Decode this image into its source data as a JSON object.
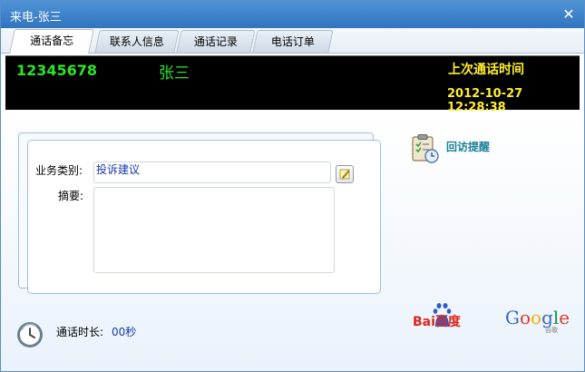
{
  "window": {
    "title": "来电-张三",
    "close_glyph": "✕"
  },
  "tabs": [
    {
      "label": "通话备忘",
      "active": true
    },
    {
      "label": "联系人信息",
      "active": false
    },
    {
      "label": "通话记录",
      "active": false
    },
    {
      "label": "电话订单",
      "active": false
    }
  ],
  "status": {
    "phone_number": "12345678",
    "caller_name": "张三",
    "last_call_label": "上次通话时间",
    "last_call_time": "2012-10-27 12:28:38"
  },
  "form": {
    "business_type_label": "业务类别:",
    "business_type_value": "投诉建议",
    "summary_label": "摘要:",
    "summary_value": ""
  },
  "actions": {
    "revisit_reminder": "回访提醒"
  },
  "footer": {
    "duration_label": "通话时长:",
    "duration_value": "00秒"
  },
  "logos": {
    "baidu_text": "Bai百度",
    "google_text": "Google",
    "google_sub": "谷歌"
  },
  "colors": {
    "titlebar": "#3a80c8",
    "digital_green": "#2ae52a",
    "digital_yellow": "#ffee28",
    "link_teal": "#1d8097",
    "value_blue": "#173aa6"
  },
  "icons": {
    "close": "close-icon",
    "edit": "edit-note-icon",
    "revisit": "clipboard-clock-icon",
    "duration": "history-clock-icon"
  }
}
